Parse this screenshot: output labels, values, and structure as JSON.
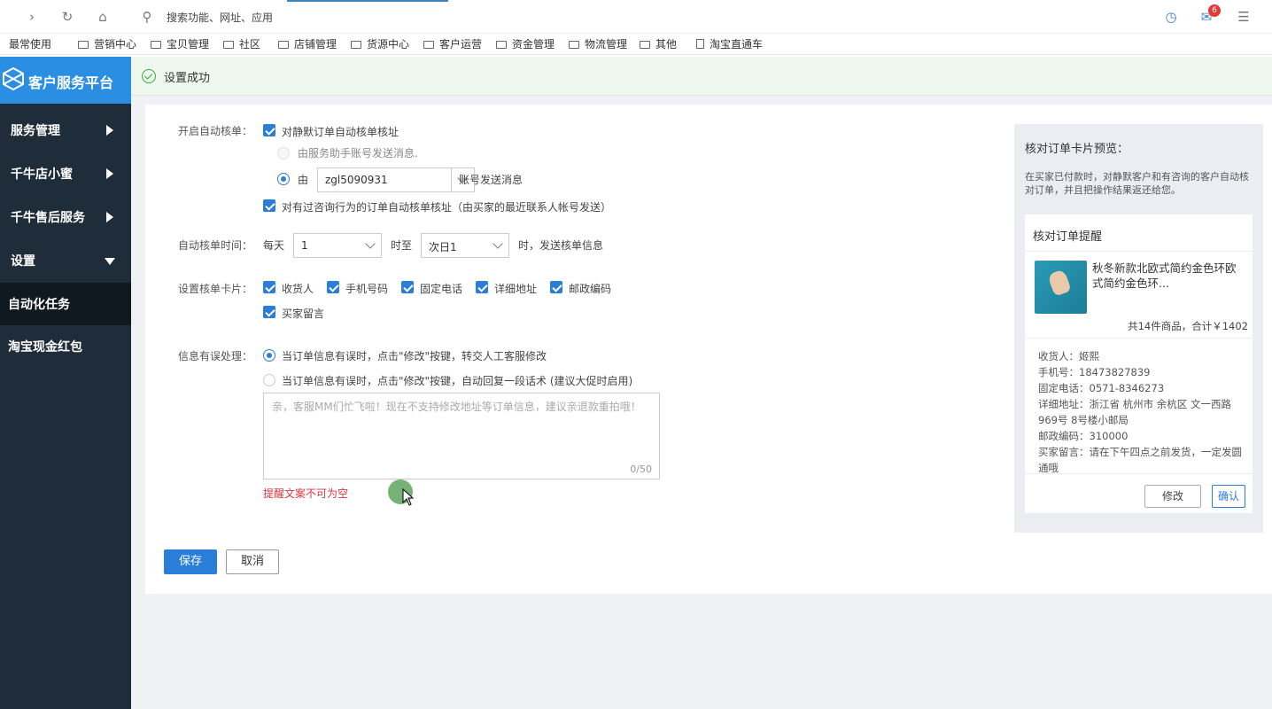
{
  "browser": {
    "address_placeholder": "搜索功能、网址、应用",
    "mail_badge": "6",
    "bookmarks": [
      "最常使用",
      "营销中心",
      "宝贝管理",
      "社区",
      "店铺管理",
      "货源中心",
      "客户运营",
      "资金管理",
      "物流管理",
      "其他",
      "淘宝直通车"
    ]
  },
  "sidebar": {
    "brand": "客户服务平台",
    "items": [
      {
        "label": "服务管理"
      },
      {
        "label": "千牛店小蜜"
      },
      {
        "label": "千牛售后服务"
      },
      {
        "label": "设置"
      },
      {
        "label": "自动化任务"
      },
      {
        "label": "淘宝现金红包"
      }
    ]
  },
  "notice": {
    "success": "设置成功"
  },
  "form": {
    "auto_check": {
      "label": "开启自动核单：",
      "silent_order": "对静默订单自动核单核址",
      "via_assistant": "由服务助手账号发送消息.",
      "via_prefix": "由",
      "account": "zgl5090931",
      "via_suffix": "账号发送消息",
      "consult_order": "对有过咨询行为的订单自动核单核址（由买家的最近联系人帐号发送）"
    },
    "time": {
      "label": "自动核单时间：",
      "prefix": "每天",
      "start": "1",
      "middle": "时至",
      "end": "次日1",
      "suffix": "时，发送核单信息"
    },
    "card": {
      "label": "设置核单卡片：",
      "fields": [
        "收货人",
        "手机号码",
        "固定电话",
        "详细地址",
        "邮政编码",
        "买家留言"
      ]
    },
    "error_handling": {
      "label": "信息有误处理：",
      "option1": "当订单信息有误时，点击\"修改\"按键，转交人工客服修改",
      "option2": "当订单信息有误时，点击\"修改\"按键，自动回复一段话术 (建议大促时启用)",
      "placeholder": "亲，客服MM们忙飞啦！现在不支持修改地址等订单信息，建议亲退款重拍哦！",
      "count": "0/50",
      "error": "提醒文案不可为空"
    },
    "save": "保存",
    "cancel": "取消"
  },
  "preview": {
    "title": "核对订单卡片预览：",
    "desc": "在买家已付款时，对静默客户和有咨询的客户自动核对订单，并且把操作结果返还给您。",
    "card_title": "核对订单提醒",
    "product": "秋冬新款北欧式简约金色环欧式简约金色环...",
    "total": "共14件商品，合计￥1402",
    "info": [
      "收货人：姬熙",
      "手机号：18473827839",
      "固定电话：0571-8346273",
      "详细地址：浙江省 杭州市 余杭区 文一西路969号 8号楼小邮局",
      "邮政编码：310000",
      "买家留言：请在下午四点之前发货，一定发圆通哦"
    ],
    "edit": "修改",
    "confirm": "确认"
  }
}
